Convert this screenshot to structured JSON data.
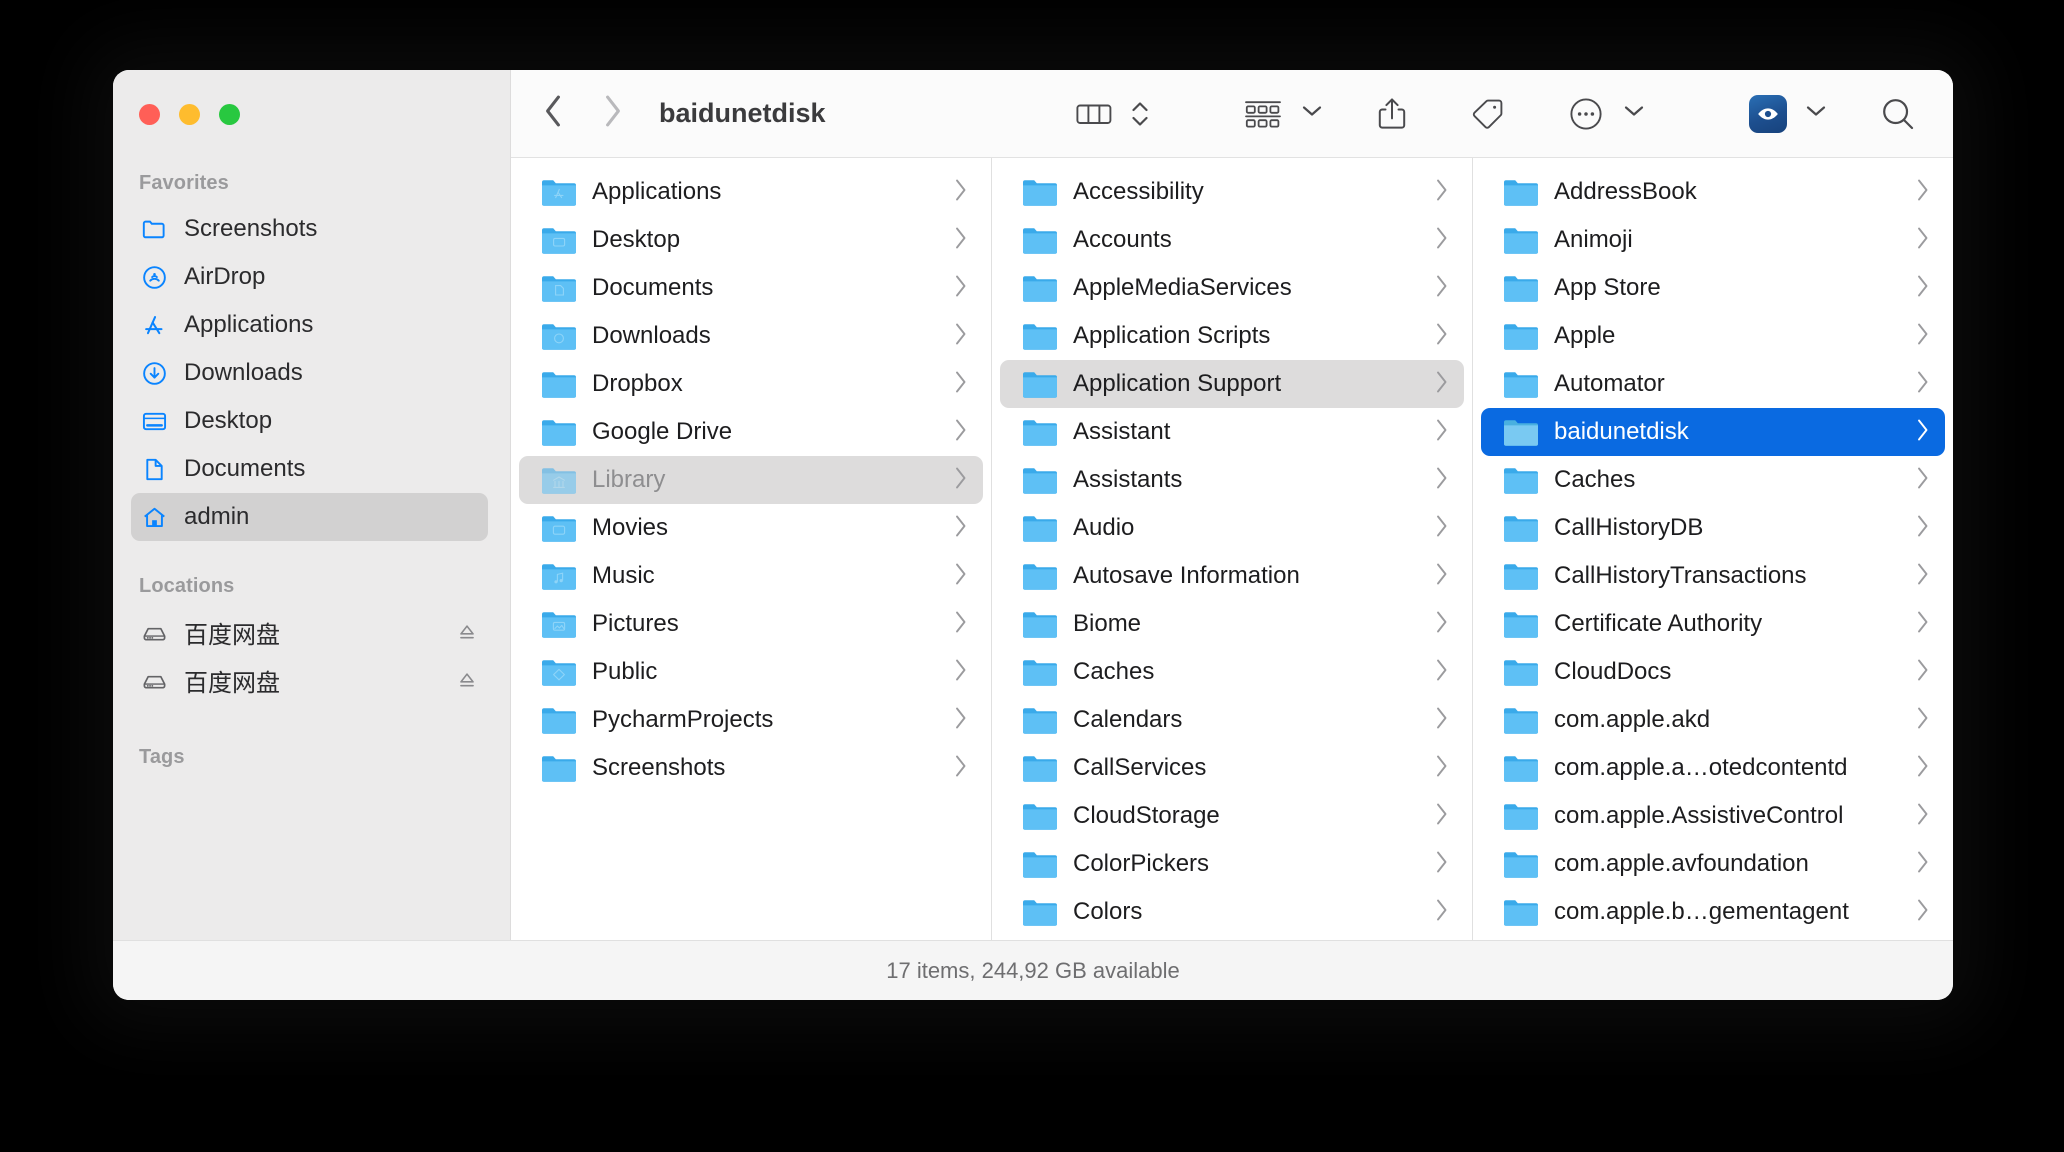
{
  "window": {
    "title": "baidunetdisk",
    "traffic_lights": [
      "close-red",
      "minimize-yellow",
      "zoom-green"
    ]
  },
  "toolbar": {
    "back_label": "Back",
    "forward_label": "Forward",
    "view_mode": "column-view",
    "arrange_label": "Group items",
    "share_label": "Share",
    "tag_label": "Edit Tags",
    "more_label": "More",
    "quicklook_label": "Preview",
    "search_label": "Search"
  },
  "sidebar": {
    "sections": [
      {
        "title": "Favorites",
        "items": [
          {
            "label": "Screenshots",
            "icon": "folder-icon",
            "selected": false,
            "ejectable": false
          },
          {
            "label": "AirDrop",
            "icon": "airdrop-icon",
            "selected": false,
            "ejectable": false
          },
          {
            "label": "Applications",
            "icon": "applications-icon",
            "selected": false,
            "ejectable": false
          },
          {
            "label": "Downloads",
            "icon": "downloads-icon",
            "selected": false,
            "ejectable": false
          },
          {
            "label": "Desktop",
            "icon": "desktop-icon",
            "selected": false,
            "ejectable": false
          },
          {
            "label": "Documents",
            "icon": "document-icon",
            "selected": false,
            "ejectable": false
          },
          {
            "label": "admin",
            "icon": "home-icon",
            "selected": true,
            "ejectable": false
          }
        ]
      },
      {
        "title": "Locations",
        "items": [
          {
            "label": "百度网盘",
            "icon": "external-drive-icon",
            "selected": false,
            "ejectable": true
          },
          {
            "label": "百度网盘",
            "icon": "external-drive-icon",
            "selected": false,
            "ejectable": true
          }
        ]
      },
      {
        "title": "Tags",
        "items": []
      }
    ]
  },
  "columns": [
    {
      "name": "home-column",
      "rows": [
        {
          "label": "Applications",
          "icon": "folder-applications",
          "state": "none"
        },
        {
          "label": "Desktop",
          "icon": "folder-desktop",
          "state": "none"
        },
        {
          "label": "Documents",
          "icon": "folder-documents",
          "state": "none"
        },
        {
          "label": "Downloads",
          "icon": "folder-downloads",
          "state": "none"
        },
        {
          "label": "Dropbox",
          "icon": "folder-plain",
          "state": "none"
        },
        {
          "label": "Google Drive",
          "icon": "folder-plain",
          "state": "none"
        },
        {
          "label": "Library",
          "icon": "folder-library",
          "state": "selected-inactive"
        },
        {
          "label": "Movies",
          "icon": "folder-movies",
          "state": "none"
        },
        {
          "label": "Music",
          "icon": "folder-music",
          "state": "none"
        },
        {
          "label": "Pictures",
          "icon": "folder-pictures",
          "state": "none"
        },
        {
          "label": "Public",
          "icon": "folder-public",
          "state": "none"
        },
        {
          "label": "PycharmProjects",
          "icon": "folder-plain",
          "state": "none"
        },
        {
          "label": "Screenshots",
          "icon": "folder-plain",
          "state": "none"
        }
      ]
    },
    {
      "name": "library-column",
      "rows": [
        {
          "label": "Accessibility",
          "icon": "folder-plain",
          "state": "none"
        },
        {
          "label": "Accounts",
          "icon": "folder-plain",
          "state": "none"
        },
        {
          "label": "AppleMediaServices",
          "icon": "folder-plain",
          "state": "none"
        },
        {
          "label": "Application Scripts",
          "icon": "folder-plain",
          "state": "none"
        },
        {
          "label": "Application Support",
          "icon": "folder-plain",
          "state": "selected-gray"
        },
        {
          "label": "Assistant",
          "icon": "folder-plain",
          "state": "none"
        },
        {
          "label": "Assistants",
          "icon": "folder-plain",
          "state": "none"
        },
        {
          "label": "Audio",
          "icon": "folder-plain",
          "state": "none"
        },
        {
          "label": "Autosave Information",
          "icon": "folder-plain",
          "state": "none"
        },
        {
          "label": "Biome",
          "icon": "folder-plain",
          "state": "none"
        },
        {
          "label": "Caches",
          "icon": "folder-plain",
          "state": "none"
        },
        {
          "label": "Calendars",
          "icon": "folder-plain",
          "state": "none"
        },
        {
          "label": "CallServices",
          "icon": "folder-plain",
          "state": "none"
        },
        {
          "label": "CloudStorage",
          "icon": "folder-plain",
          "state": "none"
        },
        {
          "label": "ColorPickers",
          "icon": "folder-plain",
          "state": "none"
        },
        {
          "label": "Colors",
          "icon": "folder-plain",
          "state": "none"
        }
      ]
    },
    {
      "name": "application-support-column",
      "rows": [
        {
          "label": "AddressBook",
          "icon": "folder-plain",
          "state": "none"
        },
        {
          "label": "Animoji",
          "icon": "folder-plain",
          "state": "none"
        },
        {
          "label": "App Store",
          "icon": "folder-plain",
          "state": "none"
        },
        {
          "label": "Apple",
          "icon": "folder-plain",
          "state": "none"
        },
        {
          "label": "Automator",
          "icon": "folder-plain",
          "state": "none"
        },
        {
          "label": "baidunetdisk",
          "icon": "folder-plain",
          "state": "selected-blue"
        },
        {
          "label": "Caches",
          "icon": "folder-plain",
          "state": "none"
        },
        {
          "label": "CallHistoryDB",
          "icon": "folder-plain",
          "state": "none"
        },
        {
          "label": "CallHistoryTransactions",
          "icon": "folder-plain",
          "state": "none"
        },
        {
          "label": "Certificate Authority",
          "icon": "folder-plain",
          "state": "none"
        },
        {
          "label": "CloudDocs",
          "icon": "folder-plain",
          "state": "none"
        },
        {
          "label": "com.apple.akd",
          "icon": "folder-plain",
          "state": "none"
        },
        {
          "label": "com.apple.a…otedcontentd",
          "icon": "folder-plain",
          "state": "none"
        },
        {
          "label": "com.apple.AssistiveControl",
          "icon": "folder-plain",
          "state": "none"
        },
        {
          "label": "com.apple.avfoundation",
          "icon": "folder-plain",
          "state": "none"
        },
        {
          "label": "com.apple.b…gementagent",
          "icon": "folder-plain",
          "state": "none"
        }
      ]
    }
  ],
  "statusbar": {
    "text": "17 items, 244,92 GB available"
  },
  "colors": {
    "selection_blue": "#0a6ae1",
    "folder_blue": "#5ec0f5",
    "sidebar_accent": "#0a84ff",
    "sidebar_bg": "#ecebeb"
  }
}
